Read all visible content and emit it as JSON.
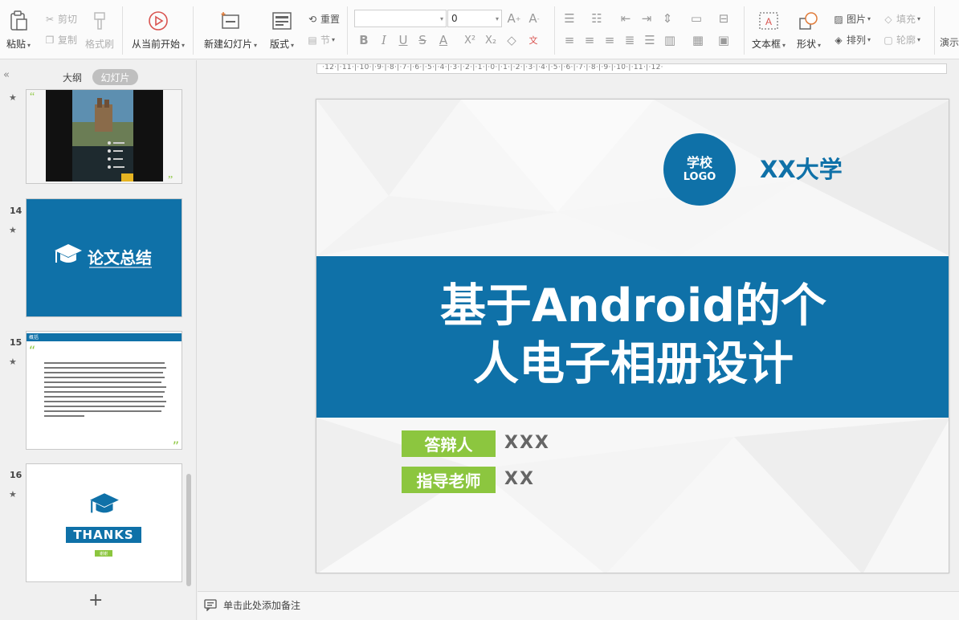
{
  "ribbon": {
    "clipboard": {
      "paste": "粘贴",
      "cut": "剪切",
      "copy": "复制",
      "format_painter": "格式刷"
    },
    "play_from_current": "从当前开始",
    "slides": {
      "new_slide": "新建幻灯片",
      "layout": "版式",
      "reset": "重置",
      "section": "节"
    },
    "font": {
      "font_name": "",
      "font_size": "0"
    },
    "drawing": {
      "textbox": "文本框",
      "shape": "形状",
      "picture": "图片",
      "arrange": "排列",
      "fill": "填充",
      "outline": "轮廓",
      "present": "演示"
    }
  },
  "left_pane": {
    "tab_outline": "大纲",
    "tab_slides": "幻灯片",
    "slides": [
      {
        "number": "",
        "star": "★"
      },
      {
        "number": "14",
        "star": "★",
        "title": "论文总结"
      },
      {
        "number": "15",
        "star": "★",
        "header": "概括"
      },
      {
        "number": "16",
        "star": "★",
        "thanks": "THANKS",
        "sub": "谢谢"
      }
    ],
    "add_slide": "+"
  },
  "ruler": "·12·|·11·|·10·|·9·|·8·|·7·|·6·|·5·|·4·|·3·|·2·|·1·|·0·|·1·|·2·|·3·|·4·|·5·|·6·|·7·|·8·|·9·|·10·|·11·|·12·",
  "slide": {
    "logo_line1": "学校",
    "logo_line2": "LOGO",
    "university": "XX大学",
    "title_line1": "基于Android的个",
    "title_line2": "人电子相册设计",
    "defender_label": "答辩人",
    "defender_value": "XXX",
    "advisor_label": "指导老师",
    "advisor_value": "XX"
  },
  "notes": {
    "placeholder": "单击此处添加备注"
  },
  "colors": {
    "brand_blue": "#0f71a8",
    "accent_green": "#8cc63f"
  }
}
